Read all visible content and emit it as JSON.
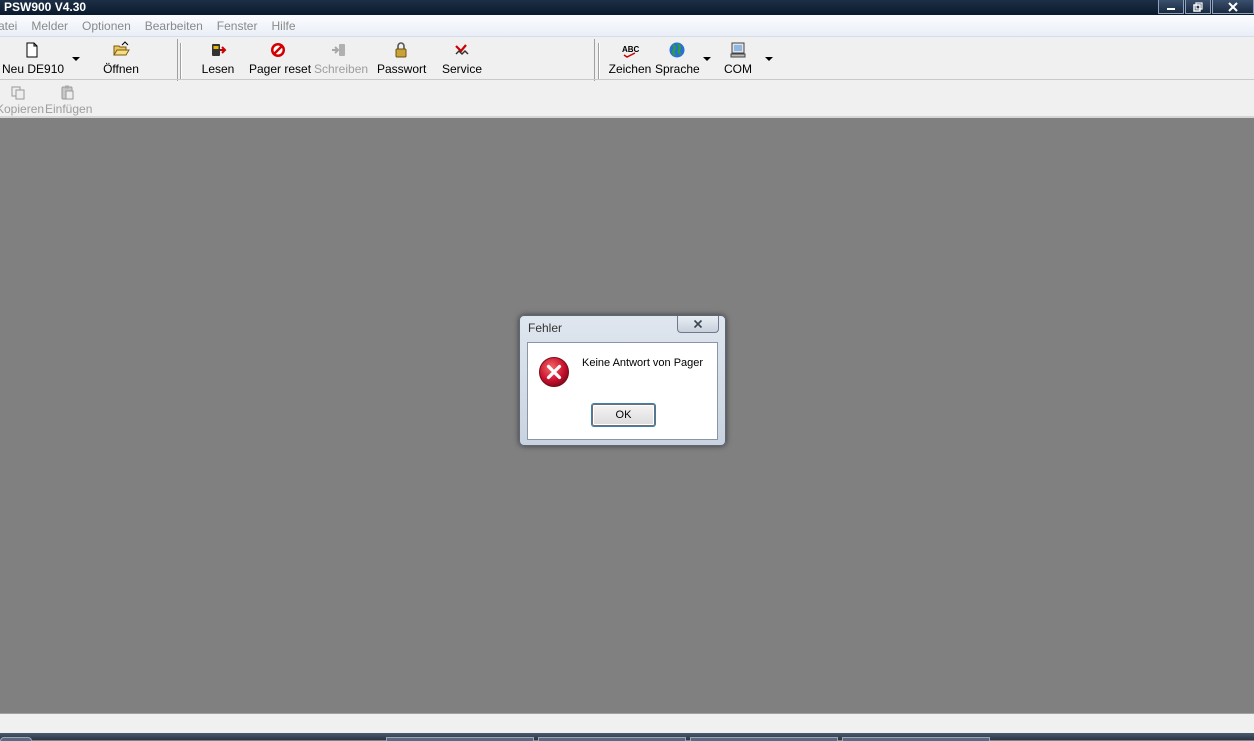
{
  "window": {
    "title": "PSW900 V4.30",
    "controls": {
      "minimize_icon": "minimize-icon",
      "restore_icon": "restore-icon",
      "close_icon": "close-icon"
    }
  },
  "menubar": {
    "items": [
      "atei",
      "Melder",
      "Optionen",
      "Bearbeiten",
      "Fenster",
      "Hilfe"
    ]
  },
  "toolbar": {
    "neu": {
      "label": "Neu DE910",
      "icon": "new-document-icon"
    },
    "oeffnen": {
      "label": "Öffnen",
      "icon": "open-folder-icon"
    },
    "lesen": {
      "label": "Lesen",
      "icon": "read-pager-icon"
    },
    "pager_reset": {
      "label": "Pager reset",
      "icon": "reset-icon"
    },
    "schreiben": {
      "label": "Schreiben",
      "icon": "write-icon"
    },
    "passwort": {
      "label": "Passwort",
      "icon": "lock-icon"
    },
    "service": {
      "label": "Service",
      "icon": "service-icon"
    },
    "zeichen": {
      "label": "Zeichen",
      "icon": "abc-icon"
    },
    "sprache": {
      "label": "Sprache",
      "icon": "globe-icon"
    },
    "com": {
      "label": "COM",
      "icon": "com-port-icon"
    },
    "kopieren": {
      "label": "Kopieren",
      "icon": "copy-icon"
    },
    "einfuegen": {
      "label": "Einfügen",
      "icon": "paste-icon"
    }
  },
  "dialog": {
    "title": "Fehler",
    "message": "Keine Antwort von Pager",
    "ok_label": "OK",
    "icon": "error-icon"
  },
  "colors": {
    "workspace": "#808080",
    "titlebar": "#0a1a2e",
    "error_red": "#c8102e"
  }
}
